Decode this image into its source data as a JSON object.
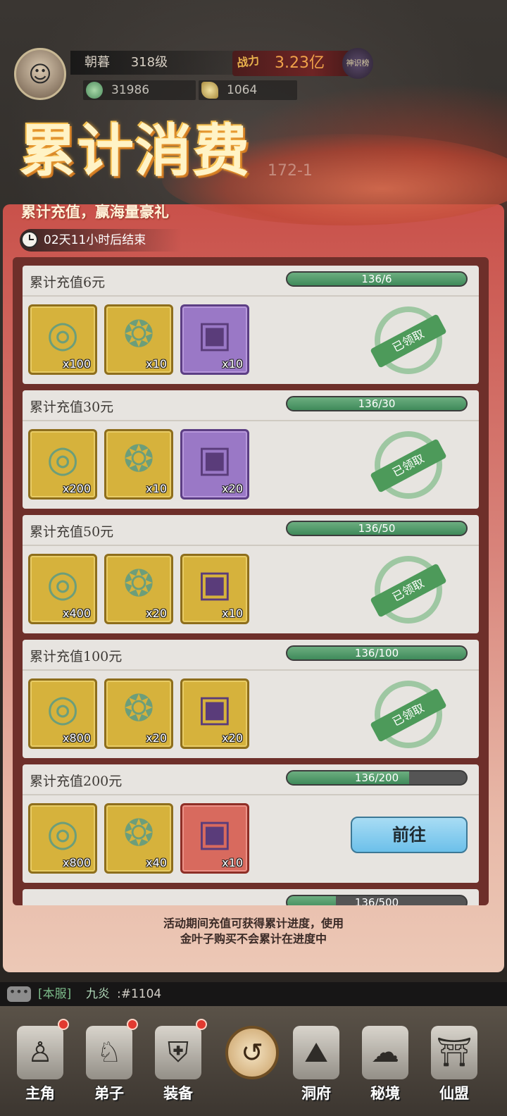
{
  "player": {
    "name": "朝暮",
    "level": "318级",
    "power_label": "战力",
    "power_value": "3.23亿",
    "rank_badge": "神识榜",
    "resource_jade": "31986",
    "resource_leaf": "1064"
  },
  "event": {
    "title": "累计消费",
    "subtitle": "累计充值，赢海量豪礼",
    "timer": "02天11小时后结束",
    "background_code": "172-1"
  },
  "tiers": [
    {
      "title": "累计充值6元",
      "progress_text": "136/6",
      "progress": 1.0,
      "rewards": [
        {
          "icon": "jade-ring-icon",
          "count": "x100",
          "rarity": "gold"
        },
        {
          "icon": "jade-pouch-icon",
          "count": "x10",
          "rarity": "gold"
        },
        {
          "icon": "treasure-chest-icon",
          "count": "x10",
          "rarity": "purple"
        }
      ],
      "status": "claimed",
      "status_label": "已领取"
    },
    {
      "title": "累计充值30元",
      "progress_text": "136/30",
      "progress": 1.0,
      "rewards": [
        {
          "icon": "jade-ring-icon",
          "count": "x200",
          "rarity": "gold"
        },
        {
          "icon": "jade-pouch-icon",
          "count": "x10",
          "rarity": "gold"
        },
        {
          "icon": "treasure-chest-icon",
          "count": "x20",
          "rarity": "purple"
        }
      ],
      "status": "claimed",
      "status_label": "已领取"
    },
    {
      "title": "累计充值50元",
      "progress_text": "136/50",
      "progress": 1.0,
      "rewards": [
        {
          "icon": "jade-ring-icon",
          "count": "x400",
          "rarity": "gold"
        },
        {
          "icon": "jade-pouch-icon",
          "count": "x20",
          "rarity": "gold"
        },
        {
          "icon": "treasure-chest-icon",
          "count": "x10",
          "rarity": "gold"
        }
      ],
      "status": "claimed",
      "status_label": "已领取"
    },
    {
      "title": "累计充值100元",
      "progress_text": "136/100",
      "progress": 1.0,
      "rewards": [
        {
          "icon": "jade-ring-icon",
          "count": "x800",
          "rarity": "gold"
        },
        {
          "icon": "jade-pouch-icon",
          "count": "x20",
          "rarity": "gold"
        },
        {
          "icon": "treasure-chest-icon",
          "count": "x20",
          "rarity": "gold"
        }
      ],
      "status": "claimed",
      "status_label": "已领取"
    },
    {
      "title": "累计充值200元",
      "progress_text": "136/200",
      "progress": 0.68,
      "rewards": [
        {
          "icon": "jade-ring-icon",
          "count": "x800",
          "rarity": "gold"
        },
        {
          "icon": "jade-pouch-icon",
          "count": "x40",
          "rarity": "gold"
        },
        {
          "icon": "treasure-chest-icon",
          "count": "x10",
          "rarity": "red"
        }
      ],
      "status": "goto",
      "status_label": "前往"
    },
    {
      "title": "",
      "progress_text": "136/500",
      "progress": 0.27,
      "rewards": [],
      "status": "hidden",
      "status_label": ""
    }
  ],
  "note": [
    "活动期间充值可获得累计进度，使用",
    "金叶子购买不会累计在进度中"
  ],
  "chat": {
    "channel": "[本服]",
    "user": "九炎",
    "message": ":#1104"
  },
  "nav": [
    {
      "label": "主角",
      "icon": "hero-icon",
      "badge": true
    },
    {
      "label": "弟子",
      "icon": "disciple-icon",
      "badge": true
    },
    {
      "label": "装备",
      "icon": "equipment-icon",
      "badge": true
    },
    {
      "label": "",
      "icon": "return-icon",
      "badge": false
    },
    {
      "label": "洞府",
      "icon": "cave-icon",
      "badge": false
    },
    {
      "label": "秘境",
      "icon": "secret-realm-icon",
      "badge": false
    },
    {
      "label": "仙盟",
      "icon": "guild-icon",
      "badge": false
    }
  ]
}
